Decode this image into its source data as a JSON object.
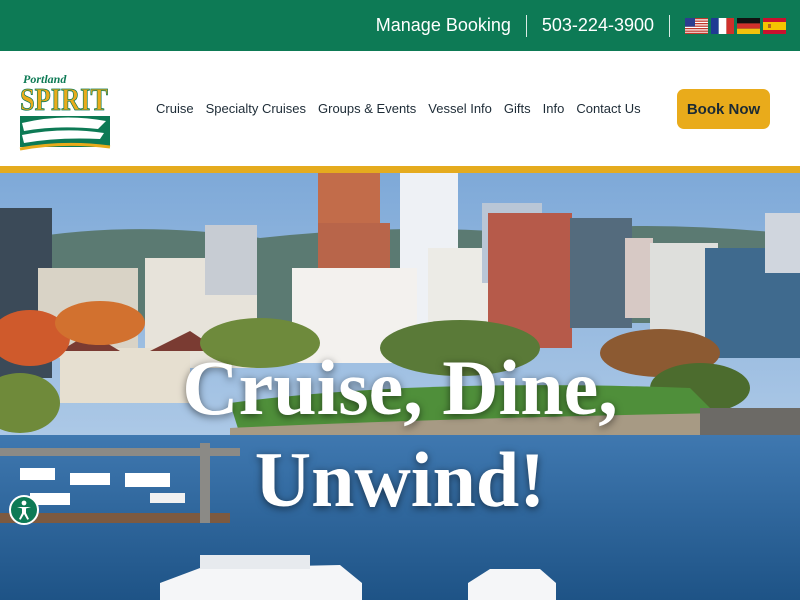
{
  "topbar": {
    "manage_booking": "Manage Booking",
    "phone": "503-224-3900",
    "languages": [
      {
        "name": "English",
        "icon": "us-flag-icon"
      },
      {
        "name": "Français",
        "icon": "fr-flag-icon"
      },
      {
        "name": "Deutsch",
        "icon": "de-flag-icon"
      },
      {
        "name": "Español",
        "icon": "es-flag-icon"
      }
    ]
  },
  "brand": {
    "logo_small": "Portland",
    "logo_big": "SPIRIT",
    "colors": {
      "green": "#0d7a55",
      "gold": "#e9ab1b"
    }
  },
  "nav": {
    "items": [
      "Cruise",
      "Specialty Cruises",
      "Groups & Events",
      "Vessel Info",
      "Gifts",
      "Info",
      "Contact Us"
    ],
    "book_now": "Book Now"
  },
  "hero": {
    "line1": "Cruise, Dine,",
    "line2": "Unwind!"
  },
  "accessibility": {
    "icon": "accessibility-icon"
  }
}
